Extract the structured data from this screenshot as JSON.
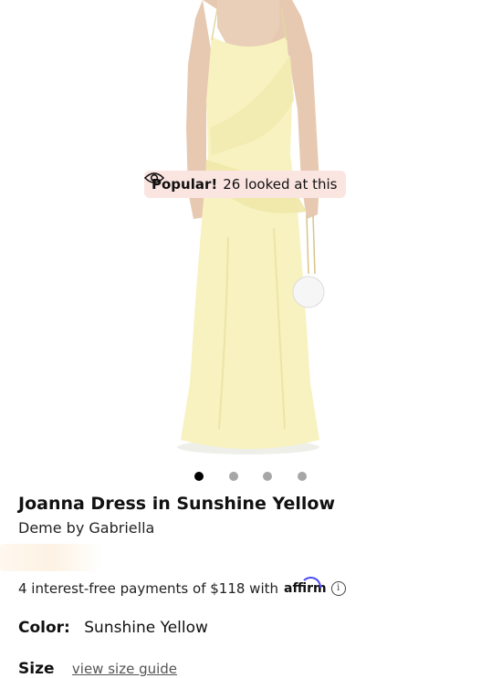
{
  "popular_badge": {
    "icon": "eye-icon",
    "strong": "Popular!",
    "text": "26 looked at this"
  },
  "carousel": {
    "count": 4,
    "active_index": 0
  },
  "product": {
    "title": "Joanna Dress in Sunshine Yellow",
    "brand": "Deme by Gabriella"
  },
  "affirm": {
    "text": "4 interest-free payments of $118 with",
    "logo": "affirm",
    "info_icon": "info-icon"
  },
  "color": {
    "label": "Color",
    "separator": ":",
    "value": "Sunshine Yellow"
  },
  "size": {
    "label": "Size",
    "guide_link": "view size guide"
  },
  "colors": {
    "dress": "#f7f2bf",
    "badge_bg": "#fbe5e1",
    "dot_active": "#000000",
    "dot_inactive": "#a6a6a6"
  }
}
